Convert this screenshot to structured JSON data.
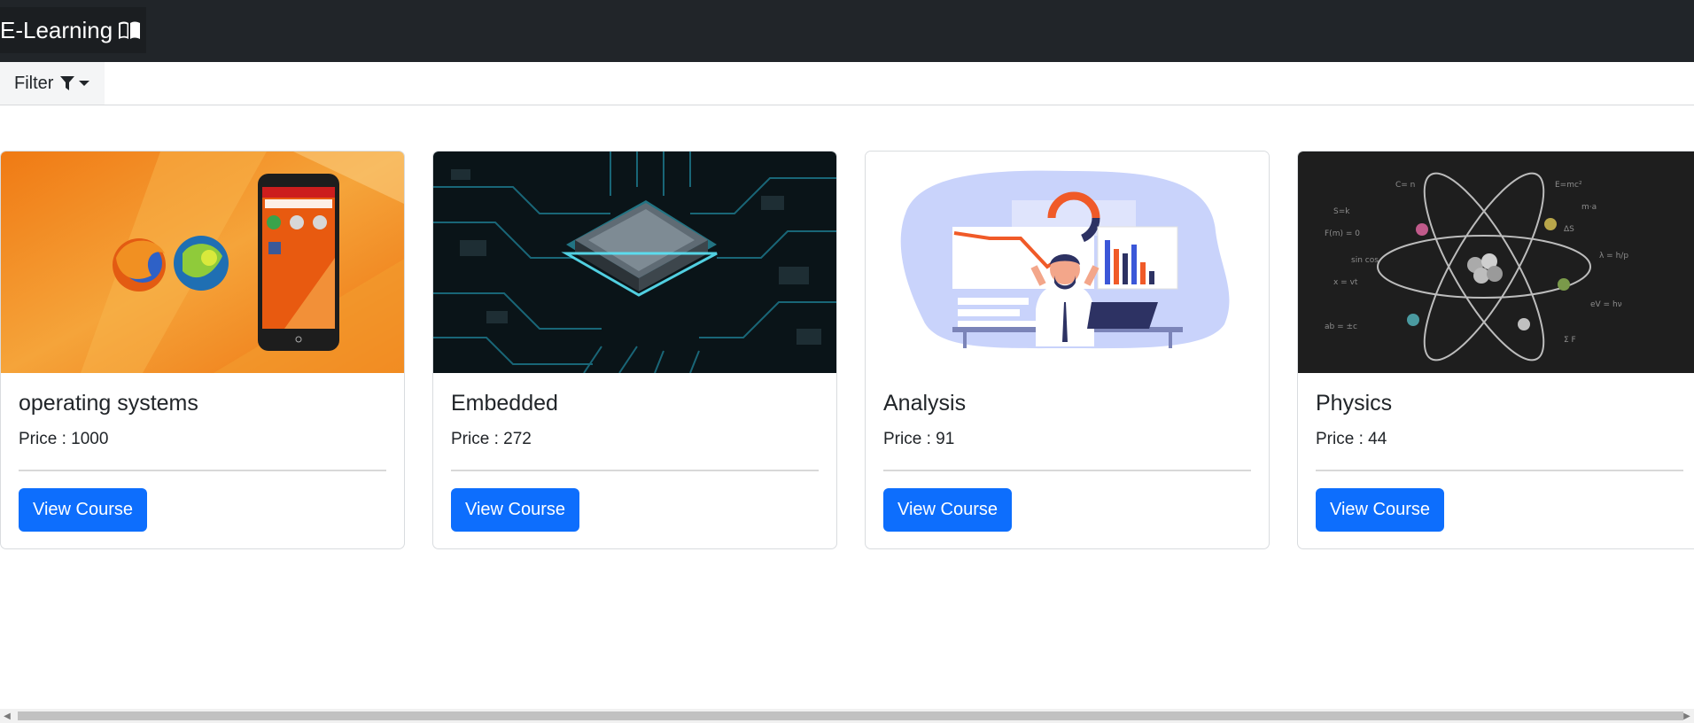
{
  "navbar": {
    "brand": "E-Learning",
    "brand_icon": "book-open-icon"
  },
  "filter": {
    "label": "Filter",
    "icon": "funnel-icon"
  },
  "courses": [
    {
      "title": "operating systems",
      "price": "Price : 1000",
      "button": "View Course"
    },
    {
      "title": "Embedded",
      "price": "Price : 272",
      "button": "View Course"
    },
    {
      "title": "Analysis",
      "price": "Price : 91",
      "button": "View Course"
    },
    {
      "title": "Physics",
      "price": "Price : 44",
      "button": "View Course"
    }
  ],
  "colors": {
    "navbar": "#212529",
    "primary": "#0d6efd",
    "card_border": "#d9dcdf"
  }
}
